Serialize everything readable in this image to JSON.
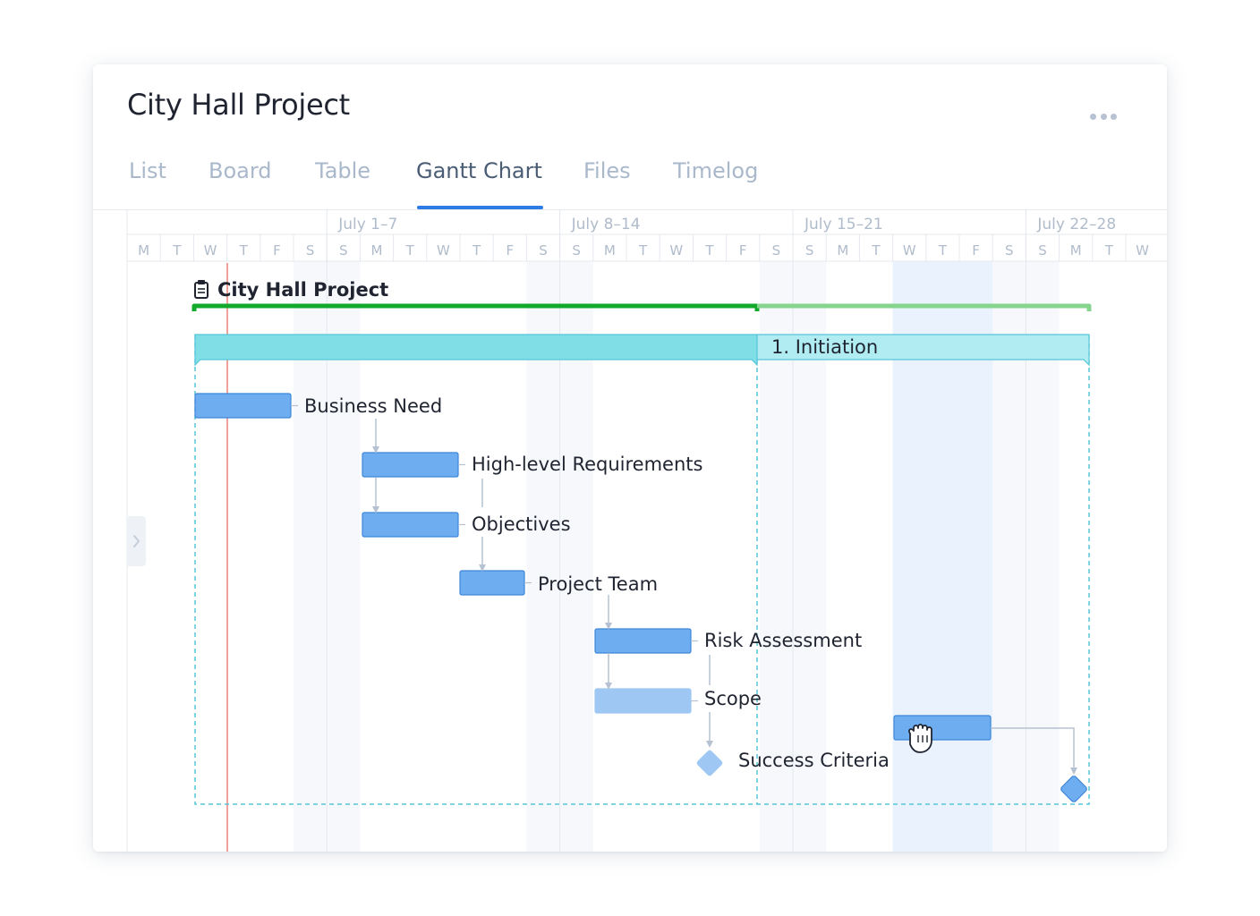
{
  "window": {
    "title": "City Hall Project",
    "menu_icon": "more-horizontal-icon"
  },
  "tabs": [
    {
      "label": "List",
      "active": false
    },
    {
      "label": "Board",
      "active": false
    },
    {
      "label": "Table",
      "active": false
    },
    {
      "label": "Gantt Chart",
      "active": true
    },
    {
      "label": "Files",
      "active": false
    },
    {
      "label": "Timelog",
      "active": false
    }
  ],
  "gantt": {
    "weeks": [
      "July 1–7",
      "July 8–14",
      "July 15–21",
      "July 22–28"
    ],
    "day_letters": [
      "M",
      "T",
      "W",
      "T",
      "F",
      "S",
      "S",
      "M",
      "T",
      "W",
      "T",
      "F",
      "S",
      "S",
      "M",
      "T",
      "W",
      "T",
      "F",
      "S",
      "S",
      "M",
      "T",
      "W",
      "T",
      "F",
      "S",
      "S",
      "M",
      "T",
      "W"
    ],
    "project": {
      "name": "City Hall Project",
      "icon": "clipboard-icon"
    },
    "phase": {
      "name": "1. Initiation"
    },
    "tasks": [
      {
        "name": "Business Need"
      },
      {
        "name": "High-level Requirements"
      },
      {
        "name": "Objectives"
      },
      {
        "name": "Project Team"
      },
      {
        "name": "Risk Assessment"
      },
      {
        "name": "Scope"
      },
      {
        "name": "Success Criteria",
        "milestone": true
      }
    ],
    "cursor_icon": "grab-hand-icon",
    "expand_icon": "chevron-right-icon",
    "colors": {
      "task": "#6eaef0",
      "task_border": "#3d86d8",
      "task_light": "#9ec8f3",
      "phase": "#7fdee6",
      "phase_light": "#b0ecf2",
      "phase_border": "#57c6d9",
      "project_bar": "#11aa2c",
      "project_bar_light": "#85d58f",
      "today_line": "#f2a09a",
      "weekend": "#f6f8fb",
      "highlight": "#eaf2fd"
    }
  }
}
